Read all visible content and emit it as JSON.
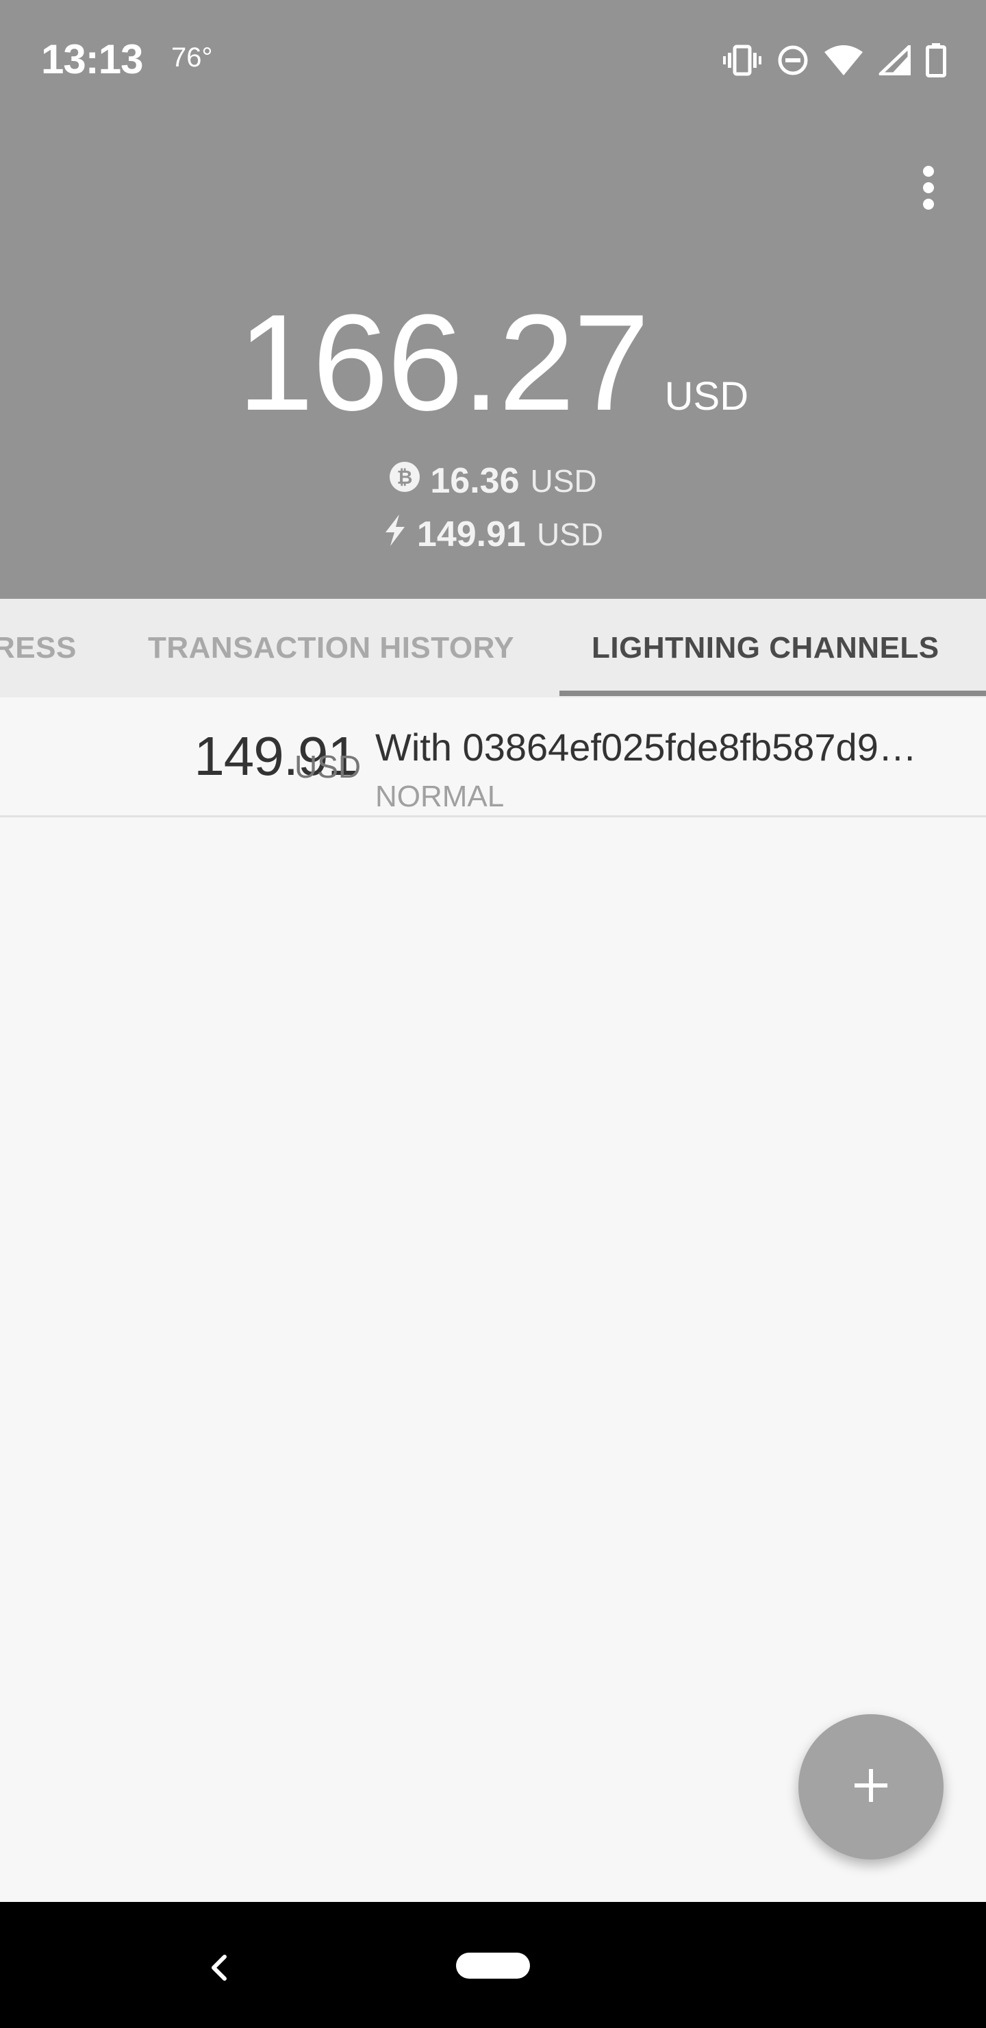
{
  "status_bar": {
    "time": "13:13",
    "temperature": "76°",
    "icons": [
      "vibrate-icon",
      "do-not-disturb-icon",
      "wifi-icon",
      "signal-icon",
      "battery-icon"
    ]
  },
  "header": {
    "menu_icon": "more-vert-icon",
    "total_balance": "166.27",
    "total_unit": "USD",
    "onchain": {
      "icon": "bitcoin-icon",
      "amount": "16.36",
      "unit": "USD"
    },
    "lightning": {
      "icon": "lightning-icon",
      "amount": "149.91",
      "unit": "USD"
    }
  },
  "tabs": [
    {
      "label": "RESS",
      "active": false
    },
    {
      "label": "TRANSACTION HISTORY",
      "active": false
    },
    {
      "label": "LIGHTNING CHANNELS",
      "active": true
    }
  ],
  "channels": [
    {
      "amount": "149.91",
      "unit": "USD",
      "title": "With 03864ef025fde8fb587d9…",
      "state": "NORMAL"
    }
  ],
  "fab": {
    "icon": "plus-icon"
  },
  "colors": {
    "header_bg": "#939393",
    "tab_bar_bg": "#ececec",
    "tab_indicator": "#8a8a8a",
    "fab_bg": "#a3a3a3",
    "content_bg": "#f7f7f7"
  }
}
